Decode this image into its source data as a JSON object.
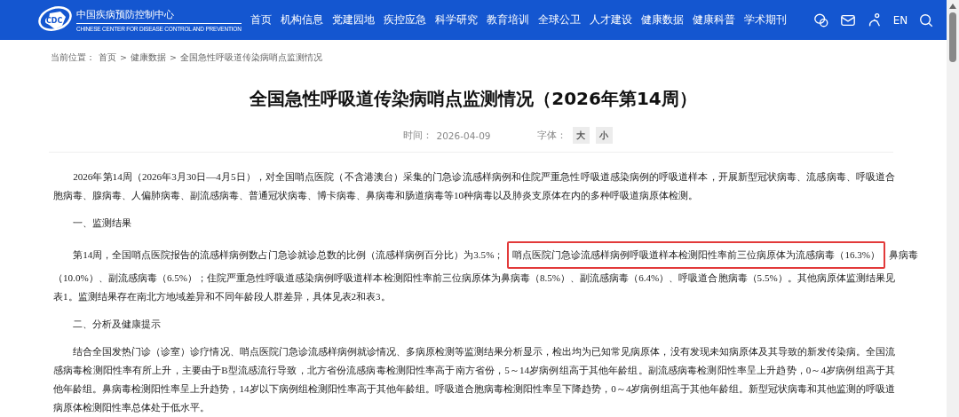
{
  "header": {
    "logo": {
      "mark": "CDC",
      "name": "中国疾病预防控制中心",
      "subtitle": "CHINESE CENTER FOR DISEASE CONTROL AND PREVENTION"
    },
    "nav": [
      "首页",
      "机构信息",
      "党建园地",
      "疾控应急",
      "科学研究",
      "教育培训",
      "全球公卫",
      "人才建设",
      "健康数据",
      "健康科普",
      "学术期刊"
    ],
    "tools": [
      {
        "kind": "wechat"
      },
      {
        "kind": "mail"
      },
      {
        "kind": "accessibility"
      },
      {
        "kind": "text",
        "label": "EN"
      },
      {
        "kind": "search"
      }
    ]
  },
  "breadcrumb": {
    "label": "当前位置：",
    "items": [
      "首页",
      "健康数据",
      "全国急性呼吸道传染病哨点监测情况"
    ],
    "separator": ">"
  },
  "article": {
    "title": "全国急性呼吸道传染病哨点监测情况（2026年第14周）",
    "time_label": "时间：",
    "time": "2026-04-09",
    "font_label": "字体：",
    "font_sizes": [
      "大",
      "小"
    ],
    "blocks": [
      {
        "kind": "paragraph",
        "parts": [
          {
            "text": "2026年第14周（2026年3月30日—4月5日），对全国哨点医院（不含港澳台）采集的门急诊流感样病例和住院严重急性呼吸道感染病例的呼吸道样本，开展新型冠状病毒、流感病毒、呼吸道合胞病毒、腺病毒、人偏肺病毒、副流感病毒、普通冠状病毒、博卡病毒、鼻病毒和肠道病毒等10种病毒以及肺炎支原体在内的多种呼吸道病原体检测。",
            "highlighted": false
          }
        ]
      },
      {
        "kind": "heading",
        "text": "一、监测结果"
      },
      {
        "kind": "paragraph",
        "parts": [
          {
            "text": "第14周，全国哨点医院报告的流感样病例数占门急诊就诊总数的比例（流感样病例百分比）为3.5%；",
            "highlighted": false
          },
          {
            "text": "哨点医院门急诊流感样病例呼吸道样本检测阳性率前三位病原体为流感病毒（16.3%）",
            "highlighted": true
          },
          {
            "text": "鼻病毒",
            "highlighted": false
          },
          {
            "text": "（10.0%）、副流感病毒（6.5%）；住院严重急性呼吸道感染病例呼吸道样本检测阳性率前三位病原体为鼻病毒（8.5%）、副流感病毒（6.4%）、呼吸道合胞病毒（5.5%）。其他病原体监测结果见表1。监测结果存在南北方地域差异和不同年龄段人群差异，具体见表2和表3。",
            "highlighted": false
          }
        ]
      },
      {
        "kind": "heading",
        "text": "二、分析及健康提示"
      },
      {
        "kind": "paragraph",
        "parts": [
          {
            "text": "结合全国发热门诊（诊室）诊疗情况、哨点医院门急诊流感样病例就诊情况、多病原检测等监测结果分析显示，检出均为已知常见病原体，没有发现未知病原体及其导致的新发传染病。全国流感病毒检测阳性率有所上升，主要由于B型流感流行导致，北方省份流感病毒检测阳性率高于南方省份，5～14岁病例组高于其他年龄组。副流感病毒检测阳性率呈上升趋势，0～4岁病例组高于其他年龄组。鼻病毒检测阳性率呈上升趋势，14岁以下病例组检测阳性率高于其他年龄组。呼吸道合胞病毒检测阳性率呈下降趋势，0～4岁病例组高于其他年龄组。新型冠状病毒和其他监测的呼吸道病原体检测阳性率总体处于低水平。",
            "highlighted": false
          }
        ]
      }
    ]
  }
}
